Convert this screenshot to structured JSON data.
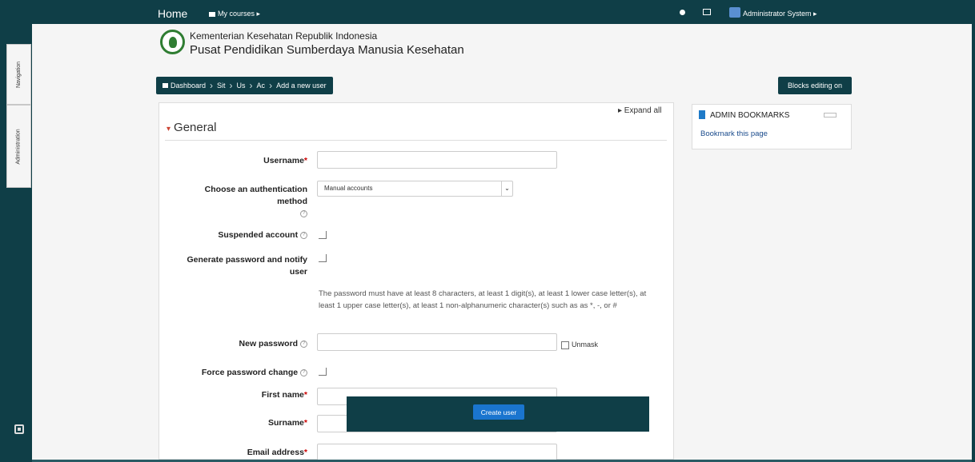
{
  "topnav": {
    "home": "Home",
    "my_courses": "My courses ▸",
    "user_name": "Administrator System ▸"
  },
  "sidebar": {
    "navigation_tab": "Navigation",
    "administration_tab": "Administration"
  },
  "org": {
    "line1": "Kementerian Kesehatan Republik Indonesia",
    "line2": "Pusat Pendidikan Sumberdaya Manusia Kesehatan"
  },
  "breadcrumb": [
    "Dashboard",
    "Sit",
    "Us",
    "Ac",
    "Add a new user"
  ],
  "blocks_editing": "Blocks editing on",
  "form": {
    "expand_all": "▸ Expand all",
    "section": "General",
    "username_label": "Username",
    "auth_label": "Choose an authentication method",
    "auth_value": "Manual accounts",
    "suspended_label": "Suspended account",
    "generate_label": "Generate password and notify user",
    "password_note": "The password must have at least 8 characters, at least 1 digit(s), at least 1 lower case letter(s), at least 1 upper case letter(s), at least 1 non-alphanumeric character(s) such as as *, -, or #",
    "new_password_label": "New password",
    "unmask": "Unmask",
    "force_change_label": "Force password change",
    "firstname_label": "First name",
    "surname_label": "Surname",
    "email_label": "Email address",
    "required_mark": "*",
    "help_mark": "?"
  },
  "bookmarks": {
    "title": "ADMIN BOOKMARKS",
    "link": "Bookmark this page"
  },
  "create_button": "Create user"
}
